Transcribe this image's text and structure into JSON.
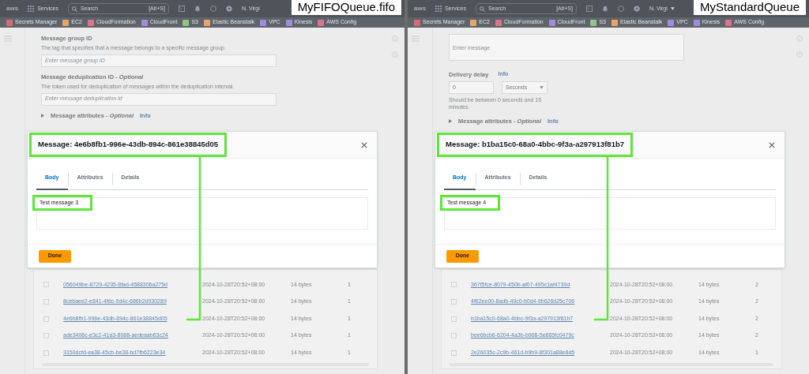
{
  "panels": [
    {
      "queue_label": "MyFIFOQueue.fifo",
      "nav": {
        "logo": "aws",
        "services": "Services",
        "search_placeholder": "Search",
        "shortcut": "[Alt+S]",
        "region": "N. Virgi",
        "region_caret": false
      },
      "favorites": [
        {
          "name": "Secrets Manager",
          "color": "#d86a74"
        },
        {
          "name": "EC2",
          "color": "#e8a56a"
        },
        {
          "name": "CloudFormation",
          "color": "#d8768a"
        },
        {
          "name": "CloudFront",
          "color": "#a48ad8"
        },
        {
          "name": "S3",
          "color": "#8fc48a"
        },
        {
          "name": "Elastic Beanstalk",
          "color": "#e8a56a"
        },
        {
          "name": "VPC",
          "color": "#9d8ce0"
        },
        {
          "name": "Kinesis",
          "color": "#9d8ce0"
        },
        {
          "name": "AWS Config",
          "color": "#d8768a"
        }
      ],
      "form": [
        {
          "kind": "input",
          "label": "Message group ID",
          "description": "The tag that specifies that a message belongs to a specific message group.",
          "placeholder": "Enter message group ID"
        },
        {
          "kind": "input",
          "label": "Message deduplication ID - *Optional*",
          "description": "The token used for deduplication of messages within the deduplication interval.",
          "placeholder": "Enter message deduplication id"
        },
        {
          "kind": "expander",
          "label": "Message attributes - *Optional*",
          "info": "Info"
        }
      ],
      "modal": {
        "title": "Message: 4e6b8fb1-996e-43db-894c-861e38845d05",
        "tabs": [
          {
            "label": "Body",
            "selected": true
          },
          {
            "label": "Attributes",
            "selected": false
          },
          {
            "label": "Details",
            "selected": false
          }
        ],
        "body": "Test message 3",
        "button": "Done"
      },
      "rows": [
        {
          "id": "056049be-8729-4235-8fad-4588306a275d",
          "sent": "2024-10-28T20:52+08:00",
          "size": "14 bytes",
          "count": "1",
          "checked": false
        },
        {
          "id": "8cebaee2-e841-4fdc-9d4c-686b2d930289",
          "sent": "2024-10-28T20:52+08:00",
          "size": "14 bytes",
          "count": "1",
          "checked": false
        },
        {
          "id": "4e6b8fb1-996e-43db-894c-861e38845d05",
          "sent": "2024-10-28T20:52+08:00",
          "size": "14 bytes",
          "count": "1",
          "checked": false
        },
        {
          "id": "ade3406c-e3c2-41a3-8088-aedeaab63c24",
          "sent": "2024-10-28T20:52+08:00",
          "size": "14 bytes",
          "count": "1",
          "checked": false
        },
        {
          "id": "3150dcfd-ea38-45cb-be38-bd7fb6223e34",
          "sent": "2024-10-28T20:52+08:00",
          "size": "14 bytes",
          "count": "1",
          "checked": false
        }
      ]
    },
    {
      "queue_label": "MyStandardQueue",
      "nav": {
        "logo": "aws",
        "services": "Services",
        "search_placeholder": "Search",
        "shortcut": "[Alt+S]",
        "region": "N. Virgi",
        "region_caret": true
      },
      "favorites": [
        {
          "name": "Secrets Manager",
          "color": "#d86a74"
        },
        {
          "name": "EC2",
          "color": "#e8a56a"
        },
        {
          "name": "CloudFormation",
          "color": "#d8768a"
        },
        {
          "name": "CloudFront",
          "color": "#a48ad8"
        },
        {
          "name": "S3",
          "color": "#8fc48a"
        },
        {
          "name": "Elastic Beanstalk",
          "color": "#e8a56a"
        },
        {
          "name": "VPC",
          "color": "#9d8ce0"
        },
        {
          "name": "Kinesis",
          "color": "#9d8ce0"
        },
        {
          "name": "AWS Config",
          "color": "#d8768a"
        }
      ],
      "form": [
        {
          "kind": "textarea",
          "placeholder": "Enter message"
        },
        {
          "kind": "delay",
          "label": "Delivery delay",
          "info": "Info",
          "value": "0",
          "unit": "Seconds",
          "hint": "Should be between 0 seconds and 15 minutes."
        },
        {
          "kind": "expander",
          "label": "Message attributes - *Optional*",
          "info": "Info"
        }
      ],
      "modal": {
        "title": "Message: b1ba15c0-68a0-4bbc-9f3a-a297913f81b7",
        "tabs": [
          {
            "label": "Body",
            "selected": true
          },
          {
            "label": "Attributes",
            "selected": false
          },
          {
            "label": "Details",
            "selected": false
          }
        ],
        "body": "Test message 4",
        "button": "Done"
      },
      "rows": [
        {
          "id": "367f5fce-8079-450b-af07-495c1af4739d",
          "sent": "2024-10-28T20:52+08:00",
          "size": "14 bytes",
          "count": "2",
          "checked": false
        },
        {
          "id": "4f62ee00-8adb-49c0-b0d4-9b626d25c706",
          "sent": "2024-10-28T20:52+08:00",
          "size": "14 bytes",
          "count": "2",
          "checked": false
        },
        {
          "id": "b1ba15c0-68a0-4bbc-9f3a-a297913f81b7",
          "sent": "2024-10-28T20:52+08:00",
          "size": "14 bytes",
          "count": "2",
          "checked": false
        },
        {
          "id": "bee6bcb6-6204-4a3b-b968-5e865fc0479c",
          "sent": "2024-10-28T20:52+08:00",
          "size": "14 bytes",
          "count": "2",
          "checked": false
        },
        {
          "id": "2e26035c-2c9b-461d-b9b9-8f301a88e8d5",
          "sent": "2024-10-28T20:52+08:00",
          "size": "14 bytes",
          "count": "1",
          "checked": false
        }
      ]
    }
  ]
}
